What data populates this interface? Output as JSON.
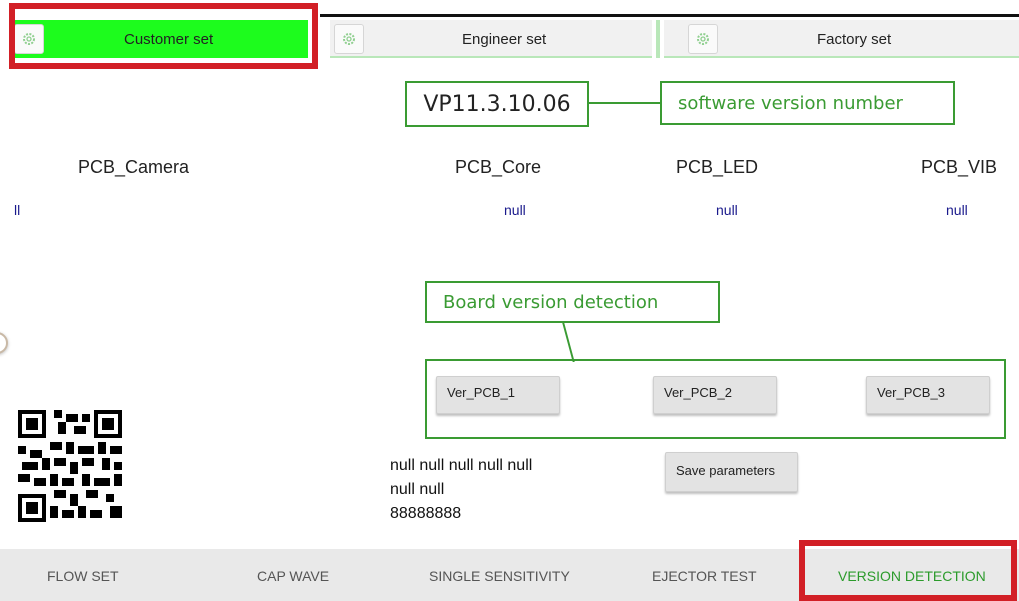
{
  "tabs": {
    "customer": "Customer set",
    "engineer": "Engineer set",
    "factory": "Factory set"
  },
  "version": {
    "value": "VP11.3.10.06",
    "annotation": "software version number"
  },
  "pcb": {
    "camera": "PCB_Camera",
    "core": "PCB_Core",
    "led": "PCB_LED",
    "vib": "PCB_VIB",
    "camera_value": "ll",
    "core_value": "null",
    "led_value": "null",
    "vib_value": "null"
  },
  "board_annotation": "Board version detection",
  "buttons": {
    "ver1": "Ver_PCB_1",
    "ver2": "Ver_PCB_2",
    "ver3": "Ver_PCB_3",
    "save": "Save parameters"
  },
  "info": {
    "line1": "null  null  null  null  null",
    "line2": "null  null",
    "line3": "88888888"
  },
  "bottom_nav": {
    "flow": "FLOW SET",
    "cap": "CAP WAVE",
    "single": "SINGLE SENSITIVITY",
    "ejector": "EJECTOR TEST",
    "version": "VERSION DETECTION"
  },
  "colors": {
    "active_tab": "#1dfc1d",
    "highlight": "#d21f26",
    "annotation": "#3a9b33",
    "active_nav": "#2b9b2b"
  }
}
